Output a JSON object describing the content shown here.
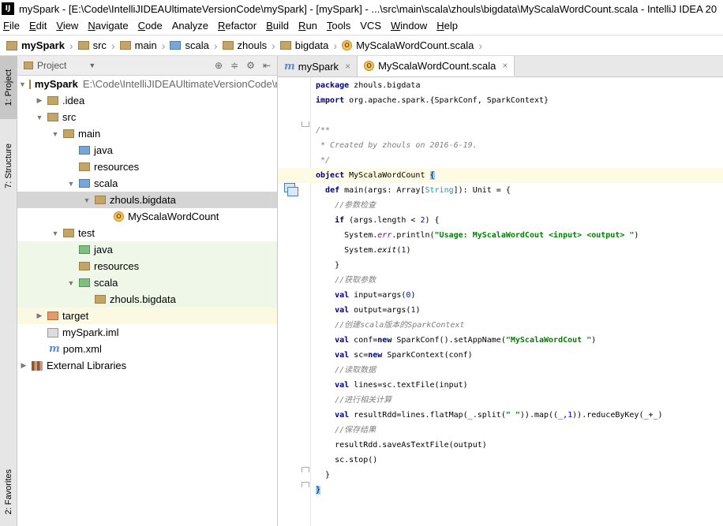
{
  "window": {
    "title": "mySpark - [E:\\Code\\IntelliJIDEAUltimateVersionCode\\mySpark] - [mySpark] - ...\\src\\main\\scala\\zhouls\\bigdata\\MyScalaWordCount.scala - IntelliJ IDEA 20"
  },
  "menu": [
    {
      "mn": "F",
      "rest": "ile"
    },
    {
      "mn": "E",
      "rest": "dit"
    },
    {
      "mn": "V",
      "rest": "iew"
    },
    {
      "mn": "N",
      "rest": "avigate"
    },
    {
      "mn": "C",
      "rest": "ode"
    },
    {
      "mn": "",
      "rest": "Analyze"
    },
    {
      "mn": "R",
      "rest": "efactor"
    },
    {
      "mn": "B",
      "rest": "uild"
    },
    {
      "mn": "R",
      "rest": "un"
    },
    {
      "mn": "T",
      "rest": "ools"
    },
    {
      "mn": "",
      "rest": "VCS"
    },
    {
      "mn": "W",
      "rest": "indow"
    },
    {
      "mn": "H",
      "rest": "elp"
    }
  ],
  "breadcrumb": [
    "mySpark",
    "src",
    "main",
    "scala",
    "zhouls",
    "bigdata",
    "MyScalaWordCount.scala"
  ],
  "left_tabs": {
    "project": "1: Project",
    "structure": "7: Structure",
    "favorites": "2: Favorites"
  },
  "project_panel": {
    "title": "Project"
  },
  "tree": {
    "root_name": "mySpark",
    "root_path": "E:\\Code\\IntelliJIDEAUltimateVersionCode\\mySpark",
    "idea": ".idea",
    "src": "src",
    "main": "main",
    "java": "java",
    "resources": "resources",
    "scala": "scala",
    "pkg": "zhouls.bigdata",
    "cls": "MyScalaWordCount",
    "test": "test",
    "test_java": "java",
    "test_resources": "resources",
    "test_scala": "scala",
    "test_pkg": "zhouls.bigdata",
    "target": "target",
    "iml": "mySpark.iml",
    "pom": "pom.xml",
    "ext": "External Libraries"
  },
  "editor_tabs": {
    "t1": "mySpark",
    "t2": "MyScalaWordCount.scala"
  },
  "code": {
    "l1a": "package",
    "l1b": " zhouls.bigdata",
    "l2a": "import",
    "l2b": " org.apache.spark.{SparkConf, SparkContext}",
    "l4": "/**",
    "l5": " * Created by zhouls on 2016-6-19.",
    "l6": " */",
    "l7a": "object",
    "l7b": " MyScalaWordCount ",
    "l7c": "{",
    "l8a": "def",
    "l8b": " main(args: Array[",
    "l8c": "String",
    "l8d": "]): Unit = {",
    "l9": "//参数检查",
    "l10a": "if",
    "l10b": " (args.length < ",
    "l10c": "2",
    "l10d": ") {",
    "l11a": "System.",
    "l11b": "err",
    "l11c": ".println(",
    "l11d": "\"Usage: MyScalaWordCout <input> <output> \"",
    "l11e": ")",
    "l12a": "System.",
    "l12b": "exit",
    "l12c": "(",
    "l12d": "1",
    "l12e": ")",
    "l13": "}",
    "l14": "//获取参数",
    "l15a": "val",
    "l15b": " input=args(",
    "l15c": "0",
    "l15d": ")",
    "l16a": "val",
    "l16b": " output=args(",
    "l16c": "1",
    "l16d": ")",
    "l17": "//创建scala版本的SparkContext",
    "l18a": "val",
    "l18b": " conf=",
    "l18c": "new",
    "l18d": " SparkConf().setAppName(",
    "l18e": "\"MyScalaWordCout \"",
    "l18f": ")",
    "l19a": "val",
    "l19b": " sc=",
    "l19c": "new",
    "l19d": " SparkContext(conf)",
    "l20": "//读取数据",
    "l21a": "val",
    "l21b": " lines=sc.textFile(input)",
    "l22": "//进行相关计算",
    "l23a": "val",
    "l23b": " resultRdd=lines.flatMap(_.split(",
    "l23c": "\" \"",
    "l23d": ")).map((_,",
    "l23e": "1",
    "l23f": ")).reduceByKey(_+_)",
    "l24": "//保存结果",
    "l25": "resultRdd.saveAsTextFile(output)",
    "l26": "sc.stop()",
    "l27": "}",
    "l28": "}"
  }
}
